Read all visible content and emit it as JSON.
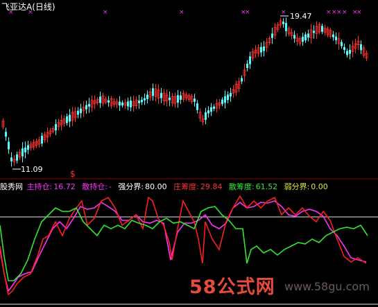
{
  "title": "飞亚达A(日线)",
  "price_high_label": "19.47",
  "price_low_label": "11.09",
  "signal_marker": "$",
  "legend": {
    "indicator": "股秀网",
    "main_hold": {
      "label": "主持仓:",
      "value": "16.72"
    },
    "retail_hold": {
      "label": "散持仓:",
      "value": "-"
    },
    "strong": {
      "label": "强分界:",
      "value": "80.00"
    },
    "banker": {
      "label": "庄筹度:",
      "value": "29.84"
    },
    "retail_chip": {
      "label": "散筹度:",
      "value": "61.52"
    },
    "weak": {
      "label": "弱分界:",
      "value": "0.00"
    }
  },
  "watermark": {
    "cn": "58公式网",
    "url": "www.58gu.com"
  },
  "colors": {
    "bg": "#000000",
    "up": "#ff3232",
    "down": "#54fcfc",
    "magenta": "#ff32ff",
    "red": "#ff1e1e",
    "green": "#32e632",
    "white": "#ffffff",
    "yellow": "#e6e632"
  },
  "chart_data": {
    "type": "candlestick+line",
    "price_range": [
      11.09,
      19.47
    ],
    "indicator_thresholds": {
      "strong": 80.0,
      "weak": 0.0
    }
  }
}
